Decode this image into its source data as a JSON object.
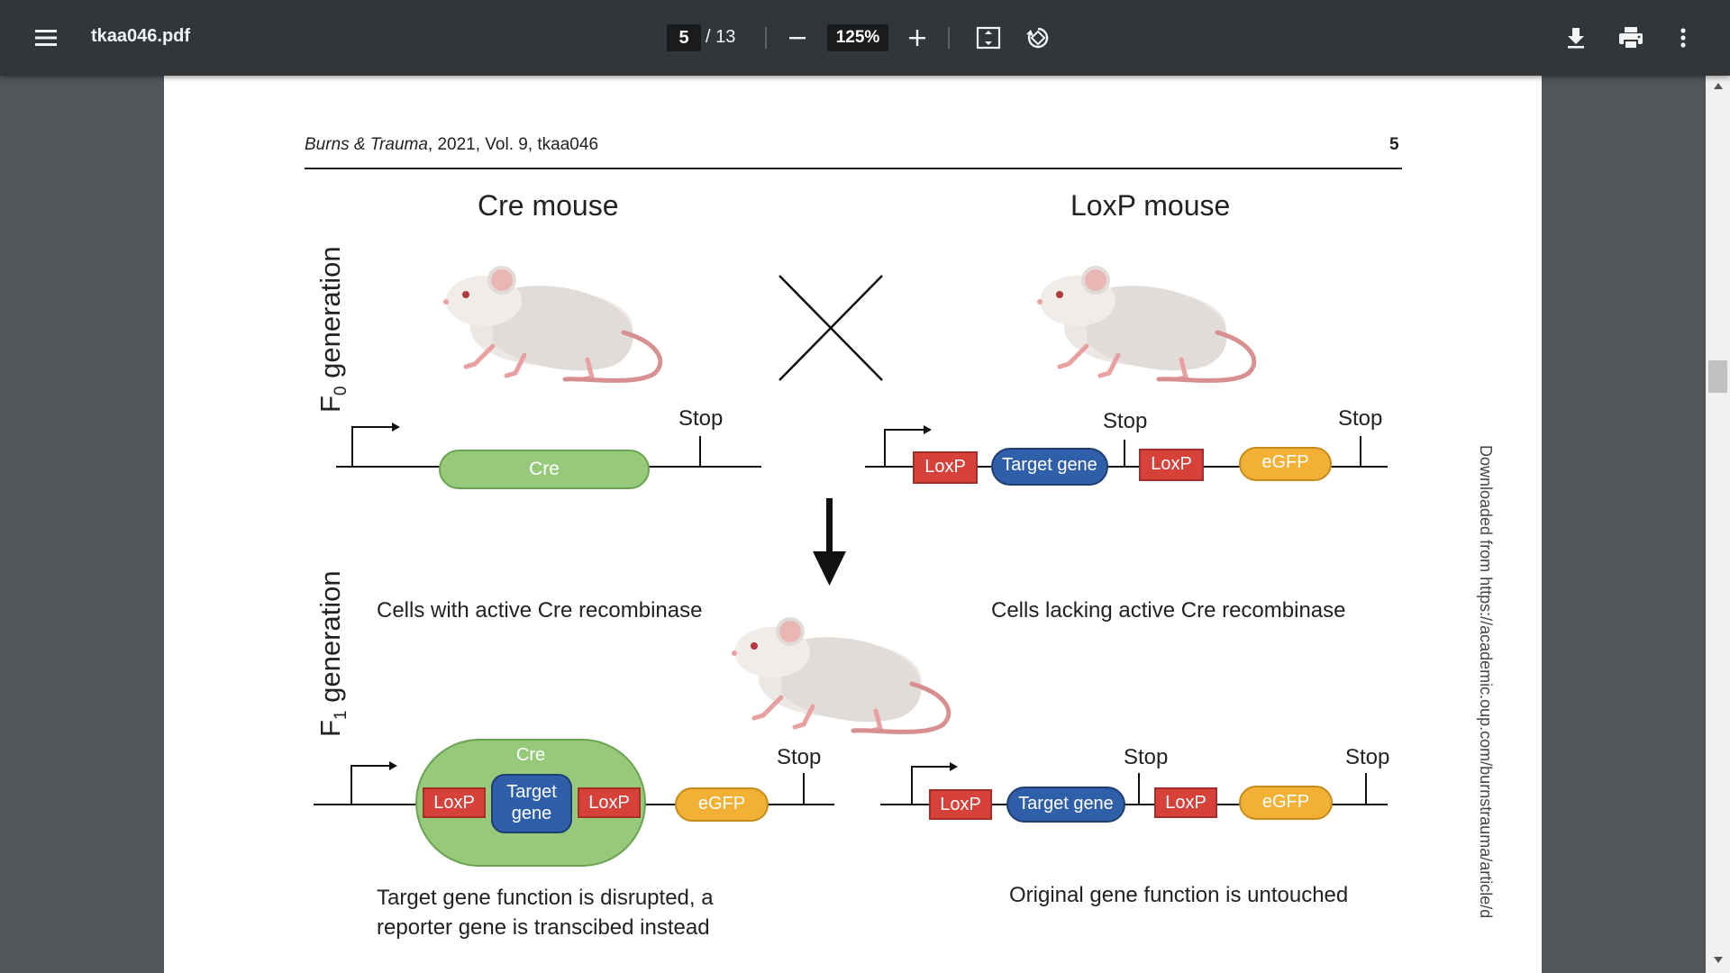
{
  "toolbar": {
    "filename": "tkaa046.pdf",
    "current_page": "5",
    "total_pages": "/ 13",
    "zoom": "125%"
  },
  "page": {
    "journal_name": "Burns & Trauma",
    "journal_meta": ", 2021, Vol. 9, tkaa046",
    "page_number": "5",
    "side_note": "Downloaded from https://academic.oup.com/burnstrauma/article/d"
  },
  "figure": {
    "cre_mouse_title": "Cre mouse",
    "loxp_mouse_title": "LoxP mouse",
    "f0_label": "F",
    "f0_sub": "0",
    "f0_rest": " generation",
    "f1_label": "F",
    "f1_sub": "1",
    "f1_rest": " generation",
    "stop": "Stop",
    "cre": "Cre",
    "loxp": "LoxP",
    "target_gene": "Target gene",
    "target": "Target",
    "gene": "gene",
    "egfp": "eGFP",
    "cells_active": "Cells with active Cre recombinase",
    "cells_lacking": "Cells lacking active Cre recombinase",
    "disrupted_line1": "Target gene function is disrupted, a",
    "disrupted_line2": "reporter gene is transcibed instead",
    "untouched": "Original gene function is untouched"
  },
  "colors": {
    "loxp": "#d6423a",
    "target": "#2f5fa8",
    "egfp": "#f2b134",
    "cre": "#97c97b"
  },
  "icons": [
    "menu-icon",
    "minus-icon",
    "plus-icon",
    "fit-page-icon",
    "rotate-icon",
    "download-icon",
    "print-icon",
    "more-vert-icon"
  ]
}
